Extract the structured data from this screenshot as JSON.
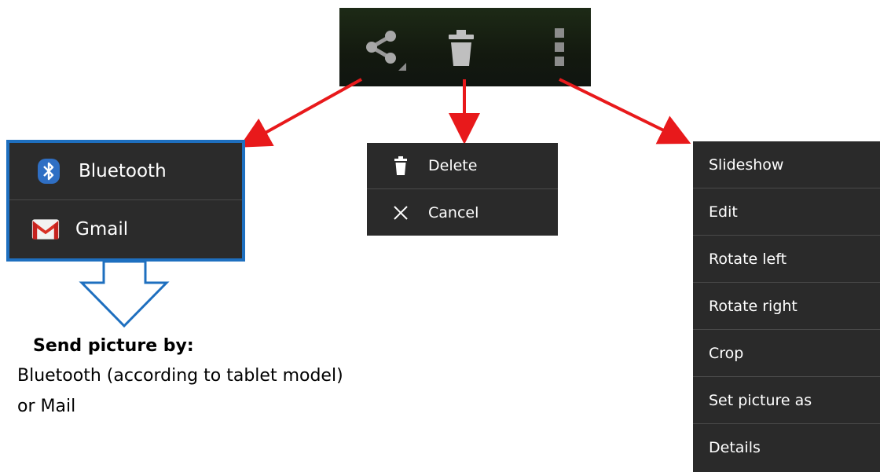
{
  "action_bar": {
    "icons": [
      "share-icon",
      "trash-icon",
      "overflow-menu-icon"
    ]
  },
  "share_menu": {
    "items": [
      {
        "label": "Bluetooth",
        "icon": "bluetooth-icon"
      },
      {
        "label": "Gmail",
        "icon": "gmail-icon"
      }
    ],
    "highlight_color": "#1e6fbf"
  },
  "delete_menu": {
    "items": [
      {
        "label": "Delete",
        "icon": "trash-icon"
      },
      {
        "label": "Cancel",
        "icon": "close-icon"
      }
    ]
  },
  "overflow_menu": {
    "items": [
      {
        "label": "Slideshow"
      },
      {
        "label": "Edit"
      },
      {
        "label": "Rotate left"
      },
      {
        "label": "Rotate right"
      },
      {
        "label": "Crop"
      },
      {
        "label": "Set picture as"
      },
      {
        "label": "Details"
      }
    ]
  },
  "caption": {
    "title": "Send picture by:",
    "line1": "Bluetooth (according to tablet model)",
    "line2": "or Mail"
  },
  "colors": {
    "arrow": "#e8191b",
    "callout_arrow": "#1e6fbf",
    "menu_bg": "#2a2a2a"
  }
}
